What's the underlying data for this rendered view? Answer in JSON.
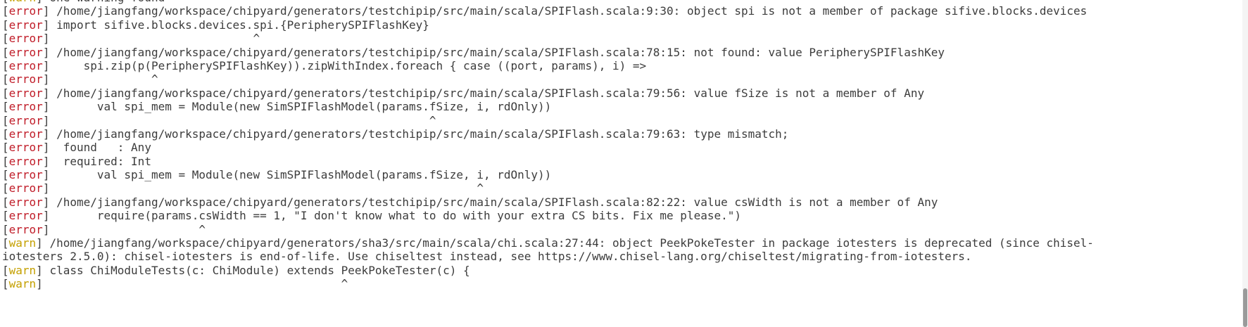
{
  "colors": {
    "error": "#c01c28",
    "warn": "#c4a000",
    "text": "#3c3c3c",
    "background": "#ffffff"
  },
  "scrollbar": {
    "position_fraction": 0.98
  },
  "lines": [
    {
      "open": "[",
      "tag": "warn",
      "close": "]",
      "text": " one warning found"
    },
    {
      "open": "[",
      "tag": "error",
      "close": "]",
      "text": " /home/jiangfang/workspace/chipyard/generators/testchipip/src/main/scala/SPIFlash.scala:9:30: object spi is not a member of package sifive.blocks.devices"
    },
    {
      "open": "[",
      "tag": "error",
      "close": "]",
      "text": " import sifive.blocks.devices.spi.{PeripherySPIFlashKey}"
    },
    {
      "open": "[",
      "tag": "error",
      "close": "]",
      "text": "                              ^"
    },
    {
      "open": "[",
      "tag": "error",
      "close": "]",
      "text": " /home/jiangfang/workspace/chipyard/generators/testchipip/src/main/scala/SPIFlash.scala:78:15: not found: value PeripherySPIFlashKey"
    },
    {
      "open": "[",
      "tag": "error",
      "close": "]",
      "text": "     spi.zip(p(PeripherySPIFlashKey)).zipWithIndex.foreach { case ((port, params), i) =>"
    },
    {
      "open": "[",
      "tag": "error",
      "close": "]",
      "text": "               ^"
    },
    {
      "open": "[",
      "tag": "error",
      "close": "]",
      "text": " /home/jiangfang/workspace/chipyard/generators/testchipip/src/main/scala/SPIFlash.scala:79:56: value fSize is not a member of Any"
    },
    {
      "open": "[",
      "tag": "error",
      "close": "]",
      "text": "       val spi_mem = Module(new SimSPIFlashModel(params.fSize, i, rdOnly))"
    },
    {
      "open": "[",
      "tag": "error",
      "close": "]",
      "text": "                                                        ^"
    },
    {
      "open": "[",
      "tag": "error",
      "close": "]",
      "text": " /home/jiangfang/workspace/chipyard/generators/testchipip/src/main/scala/SPIFlash.scala:79:63: type mismatch;"
    },
    {
      "open": "[",
      "tag": "error",
      "close": "]",
      "text": "  found   : Any"
    },
    {
      "open": "[",
      "tag": "error",
      "close": "]",
      "text": "  required: Int"
    },
    {
      "open": "[",
      "tag": "error",
      "close": "]",
      "text": "       val spi_mem = Module(new SimSPIFlashModel(params.fSize, i, rdOnly))"
    },
    {
      "open": "[",
      "tag": "error",
      "close": "]",
      "text": "                                                               ^"
    },
    {
      "open": "[",
      "tag": "error",
      "close": "]",
      "text": " /home/jiangfang/workspace/chipyard/generators/testchipip/src/main/scala/SPIFlash.scala:82:22: value csWidth is not a member of Any"
    },
    {
      "open": "[",
      "tag": "error",
      "close": "]",
      "text": "       require(params.csWidth == 1, \"I don't know what to do with your extra CS bits. Fix me please.\")"
    },
    {
      "open": "[",
      "tag": "error",
      "close": "]",
      "text": "                      ^"
    },
    {
      "open": "[",
      "tag": "warn",
      "close": "]",
      "text": " /home/jiangfang/workspace/chipyard/generators/sha3/src/main/scala/chi.scala:27:44: object PeekPokeTester in package iotesters is deprecated (since chisel-"
    },
    {
      "open": "",
      "tag": "",
      "close": "",
      "text": "iotesters 2.5.0): chisel-iotesters is end-of-life. Use chiseltest instead, see https://www.chisel-lang.org/chiseltest/migrating-from-iotesters."
    },
    {
      "open": "[",
      "tag": "warn",
      "close": "]",
      "text": " class ChiModuleTests(c: ChiModule) extends PeekPokeTester(c) {"
    },
    {
      "open": "[",
      "tag": "warn",
      "close": "]",
      "text": "                                            ^"
    }
  ]
}
